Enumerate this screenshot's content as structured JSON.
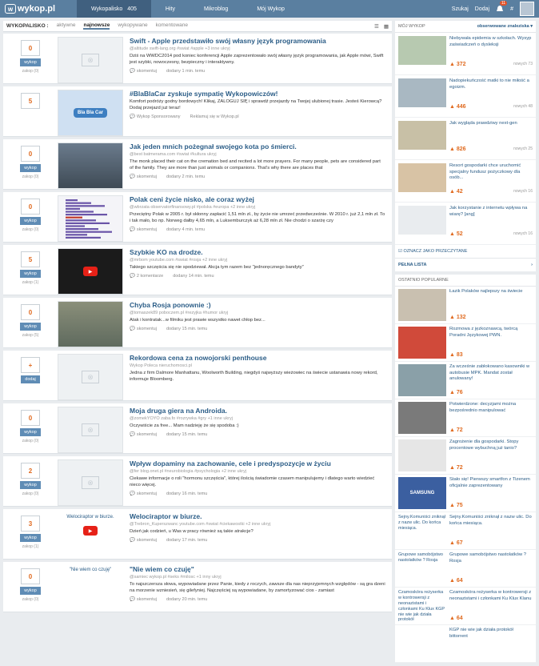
{
  "topbar": {
    "logo": "wykop.pl",
    "nav": [
      {
        "label": "Wykopalisko",
        "count": "405",
        "active": true
      },
      {
        "label": "Hity",
        "count": "",
        "active": false
      },
      {
        "label": "Mikroblog",
        "count": "",
        "active": false
      },
      {
        "label": "Mój Wykop",
        "count": "",
        "active": false
      }
    ],
    "search": "Szukaj",
    "add": "Dodaj",
    "notif_count": "11"
  },
  "tabs": {
    "label": "WYKOPALISKO :",
    "items": [
      "aktywne",
      "najnowsze",
      "wykopywane",
      "komentowane"
    ],
    "active": "najnowsze"
  },
  "entries": [
    {
      "votes": "0",
      "btn": "wykop",
      "sub": "zakop (0)",
      "thumb": "ph",
      "title": "Swift - Apple przedstawiło swój własny język programowania",
      "meta": "@altitude swift-lang.org   #swiat #apple +3 inne   ukryj",
      "desc": "Dziś na WWDC2014 pod koniec konferencji Apple zaprezentowało swój własny język programowania, jak Apple mówi, Swift jest szybki, nowoczesny, bezpieczny i interaktywny.",
      "comments": "skomentuj",
      "time": "dodany 1 min. temu"
    },
    {
      "votes": "5",
      "btn": "",
      "sub": "",
      "thumb": "bbc",
      "title": "#BlaBlaCar zyskuje sympatię Wykopowiczów!",
      "meta": "",
      "desc": "Komfort podróży godny bordowych! Klikaj, ZALOGUJ SIĘ i sprawdź przejazdy na Twojej ulubionej trasie. Jesteś Kierowcą? Dodaj przejazd już teraz!",
      "comments": "Wykop Sponsorowany",
      "time": "Reklamuj się w Wykop.pl"
    },
    {
      "votes": "0",
      "btn": "wykop",
      "sub": "zakop (0)",
      "thumb": "cat",
      "title": "Jak jeden mnich pożegnał swojego kota po śmierci.",
      "meta": "@best batmerama.com   #swiat #kultura   ukryj",
      "desc": "The monk placed their cat on the cremation bed and recited a lot more prayers. For many people, pets are considered part of the family. They are more than just animals or companions. That's why there are places that",
      "comments": "skomentuj",
      "time": "dodany 2 min. temu"
    },
    {
      "votes": "0",
      "btn": "wykop",
      "sub": "zakop (0)",
      "thumb": "chart",
      "title": "Polak ceni życie nisko, ale coraz wyżej",
      "meta": "@wbrzata observatorfinansowy.pl   #polska #europa +2 inne   ukryj",
      "desc": "Przeciętny Polak w 2005 r. był skłonny zapłacić 1,51 mln zł., by życie nie umrzeć przedwcześnie. W 2010 r. już 2,1 mln zł. To i tak mało, bo np. Norweg dałby 4,65 mln, a Luksemburczyk aż 6,28 mln zł. Nie chodzi o szarżę czy",
      "comments": "skomentuj",
      "time": "dodany 4 min. temu"
    },
    {
      "votes": "5",
      "btn": "wykop",
      "sub": "zakop (1)",
      "thumb": "video",
      "title": "Szybkie KO na drodze.",
      "meta": "@mrbom youtube.com   #swiat #rosja +2 inne   ukryj",
      "desc": "Takiego szczęścia się nie spodziewał. Akcja tym razem bez \"jednoręcznego bandyty\"",
      "comments": "2 komentarze",
      "time": "dodany 14 min. temu"
    },
    {
      "votes": "0",
      "btn": "wykop",
      "sub": "zakop (5)",
      "thumb": "car",
      "title": "Chyba Rosja ponownie :)",
      "meta": "@tomaszek89 poboczem.pl   #rezyjka #humor   ukryj",
      "desc": "Atak i kontratak...w filmiku jest prawie wszystko nawet chłop bez...",
      "comments": "skomentuj",
      "time": "dodany 15 min. temu"
    },
    {
      "votes": "+",
      "btn": "dodaj",
      "sub": "",
      "thumb": "ph",
      "title": "Rekordowa cena za nowojorski penthouse",
      "meta": "Wykop Poleca nieruchomosci.pl",
      "desc": "Jedna z firm Dalmore Manhattanu, Woolworth Building, niegdyś najwyższy wieżowiec na świecie ustanawia nowy rekord, informuje Bloomberg.",
      "comments": "",
      "time": ""
    },
    {
      "votes": "0",
      "btn": "wykop",
      "sub": "zakop (0)",
      "thumb": "ph",
      "title": "Moja druga giera na Androida.",
      "meta": "@zomekYOYO zaba.fo   #rozrywka #gry +1 inne   ukryj",
      "desc": "Oczywiście za free... Mam nadzieję że się spodoba :)",
      "comments": "skomentuj",
      "time": "dodany 15 min. temu"
    },
    {
      "votes": "2",
      "btn": "wykop",
      "sub": "zakop (0)",
      "thumb": "ph",
      "title": "Wpływ dopaminy na zachowanie, cele i predyspozycje w życiu",
      "meta": "@fer blog.onet.pl   #neurobiologia #psychologia +2 inne   ukryj",
      "desc": "Ciekawe informacje o roli \"hormonu szczęścia\", której ilością świadomie czasem manipulujemy i dlatego warto wiedzieć nieco więcej.",
      "comments": "skomentuj",
      "time": "dodany 16 min. temu"
    },
    {
      "votes": "3",
      "btn": "wykop",
      "sub": "zakop (1)",
      "thumb": "white",
      "thumb_text": "Welociraptor w biurze.",
      "title": "Welociraptor w biurze.",
      "meta": "@Trebron_Kuperszwanc youtube.com   #swiat #ciekawostki +2 inne   ukryj",
      "desc": "Dzień jak codzień, u Was w pracy również są takie atrakcje?",
      "comments": "skomentuj",
      "time": "dodany 17 min. temu"
    },
    {
      "votes": "0",
      "btn": "wykop",
      "sub": "zakop (0)",
      "thumb": "white",
      "thumb_text": "\"Nie wiem co czuję\"",
      "title": "\"Nie wiem co czuję\"",
      "meta": "@samiec wykop.pl   #seks #milosc +1 inny   ukryj",
      "desc": "To najszczersza słowa, wypowiadane przez Panie, kiedy z roczych, zawsze dla nas nieprzyjemnych względów - są gra dzeni na morzenie wzniesień, się gilefyniej. Najczęściej są wypowiadane, by zamortyzować cios - zamiast",
      "comments": "skomentuj",
      "time": "dodany 20 min. temu"
    }
  ],
  "sidebar": {
    "moj_wykop": "MÓJ WYKOP",
    "filter": "obserwowane znaleziska",
    "items": [
      {
        "title": "Niebywała epidemia w szkołach. Wysyp zaświadczeń o dysleksji",
        "count": "372",
        "comments": "nowych 73"
      },
      {
        "title": "Nadopiekuńczość matki to nie miłość a egoizm.",
        "count": "446",
        "comments": "nowych 48"
      },
      {
        "title": "Jak wygląda prawdziwy next-gen",
        "count": "826",
        "comments": "nowych 25"
      },
      {
        "title": "Resort gospodarki chce uruchomić specjalny fundusz pożyczkowy dla osób...",
        "count": "42",
        "comments": "nowych 16"
      },
      {
        "title": "Jak korzystanie z internetu wpływa na wiarę? [ang]",
        "count": "52",
        "comments": "nowych 16"
      }
    ],
    "mark_read": "OZNACZ JAKO PRZECZYTANE",
    "full_list": "PEŁNA LISTA",
    "popular_head": "OSTATNIO POPULARNE",
    "popular": [
      {
        "title": "Łazik Polaków najlepszy na świecie",
        "count": "132",
        "thumb": "img"
      },
      {
        "title": "Rozmowa z jęzkoznawcą, twórcą Poradni Językowej PWN.",
        "count": "83",
        "thumb": "img"
      },
      {
        "title": "Za wcześnie zabłokowano kasowniki w autobusie MPK. Mandat został anulowany!",
        "count": "76",
        "thumb": "img"
      },
      {
        "title": "Potwierdzone: decyzjami można bezpośrednio manipulować",
        "count": "72",
        "thumb": "img"
      },
      {
        "title": "Zagrożenie dla gospodarki. Stopy procentowe wybuchną już tanio?",
        "count": "72",
        "thumb": "img"
      },
      {
        "title": "Stało się! Pierwszy smartfon z Tizenem oficjalnie zaprezentowany",
        "count": "75",
        "thumb": "samsung"
      },
      {
        "title": "Sejny.Komuniści zniknął z nazw ulic. Do końca miesiąca.",
        "count": "67",
        "thumb": "text",
        "thumb_text": "Sejny.Komuniści zniknął z nazw ulic. Do końca miesiąca."
      },
      {
        "title": "Grupowe samobójstwo nastolatków ? Rosja",
        "count": "64",
        "thumb": "text",
        "thumb_text": "Grupowe samobójstwo nastolatków ? Rosja"
      },
      {
        "title": "Czamoskóra reżyserka w kontrowersji z neonazistami i członkami Ku Klux Klanu",
        "count": "64",
        "thumb": "text",
        "thumb_text": "Czamoskóra reżyserka w kontrowersji z neonazistami i członkami Ku Klux KGP nie wie jak działa protokół"
      },
      {
        "title": "KGP nie wie jak działa protokół bittorrent",
        "count": "",
        "thumb": "text",
        "thumb_text": ""
      }
    ]
  }
}
